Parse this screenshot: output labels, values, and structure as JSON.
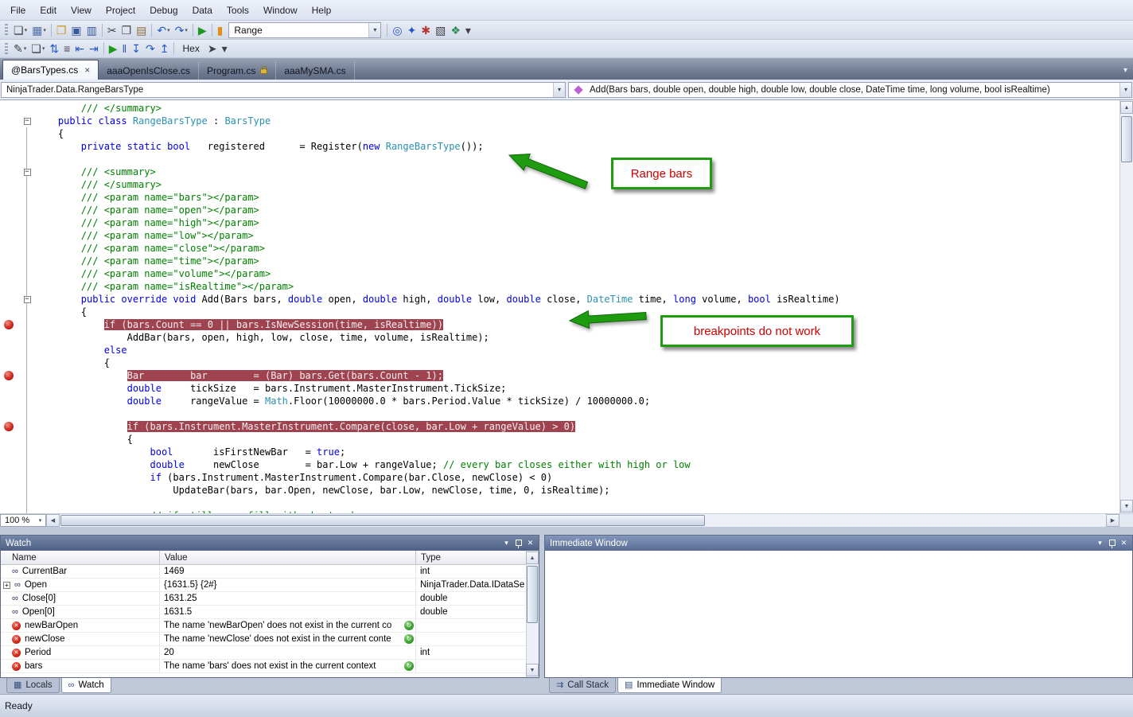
{
  "colors": {
    "breakpoint_highlight": "#A04350",
    "breakpoint_dot": "#CE2A1F",
    "annotation_border": "#1E9B0E",
    "annotation_text": "#D10000",
    "keyword": "#0000E8",
    "user_type": "#2B91AF",
    "comment": "#008000"
  },
  "menu": {
    "items": [
      "File",
      "Edit",
      "View",
      "Project",
      "Debug",
      "Data",
      "Tools",
      "Window",
      "Help"
    ]
  },
  "toolbar1": {
    "items": [
      {
        "k": "g"
      },
      {
        "k": "i",
        "n": "new-file-icon",
        "g": "❏",
        "c": "#3f4043",
        "caret": true
      },
      {
        "k": "i",
        "n": "add-item-icon",
        "g": "▦",
        "c": "#4f6fa8",
        "caret": true
      },
      {
        "k": "s"
      },
      {
        "k": "i",
        "n": "open-file-icon",
        "g": "❒",
        "c": "#c9971c"
      },
      {
        "k": "i",
        "n": "save-icon",
        "g": "▣",
        "c": "#34589c"
      },
      {
        "k": "i",
        "n": "save-all-icon",
        "g": "▥",
        "c": "#34589c"
      },
      {
        "k": "s"
      },
      {
        "k": "i",
        "n": "cut-icon",
        "g": "✂",
        "c": "#44464a"
      },
      {
        "k": "i",
        "n": "copy-icon",
        "g": "❐",
        "c": "#44464a"
      },
      {
        "k": "i",
        "n": "paste-icon",
        "g": "▤",
        "c": "#8a6d3b"
      },
      {
        "k": "s"
      },
      {
        "k": "i",
        "n": "undo-icon",
        "g": "↶",
        "c": "#2458c8",
        "caret": true
      },
      {
        "k": "i",
        "n": "redo-icon",
        "g": "↷",
        "c": "#2458c8",
        "caret": true
      },
      {
        "k": "s"
      },
      {
        "k": "i",
        "n": "start-debugging-icon",
        "g": "▶",
        "c": "#1d9a1d"
      },
      {
        "k": "s"
      },
      {
        "k": "i",
        "n": "new-breakpoint-icon",
        "g": "▮",
        "c": "#e09018"
      },
      {
        "k": "combo",
        "n": "solution-configurations-combo",
        "v": "Range",
        "w": 192
      },
      {
        "k": "s"
      },
      {
        "k": "i",
        "n": "find-in-files-icon",
        "g": "◎",
        "c": "#2458c8"
      },
      {
        "k": "i",
        "n": "find-symbol-icon",
        "g": "✦",
        "c": "#2458c8"
      },
      {
        "k": "i",
        "n": "build-icon",
        "g": "✱",
        "c": "#b03a2e"
      },
      {
        "k": "i",
        "n": "properties-window-icon",
        "g": "▧",
        "c": "#3f4043"
      },
      {
        "k": "i",
        "n": "extensions-icon",
        "g": "❖",
        "c": "#2e8b57"
      },
      {
        "k": "i",
        "n": "toolbar-options-icon",
        "g": "▾",
        "c": "#3f4043"
      }
    ]
  },
  "toolbar2": {
    "items": [
      {
        "k": "g"
      },
      {
        "k": "i",
        "n": "comment-icon",
        "g": "✎",
        "c": "#3f4043",
        "caret": true
      },
      {
        "k": "i",
        "n": "uncomment-icon",
        "g": "❏",
        "c": "#3f4043",
        "caret": true
      },
      {
        "k": "i",
        "n": "sort-icon",
        "g": "⇅",
        "c": "#2458c8"
      },
      {
        "k": "i",
        "n": "display-whitespace-icon",
        "g": "≡",
        "c": "#3f4043"
      },
      {
        "k": "i",
        "n": "decrease-indent-icon",
        "g": "⇤",
        "c": "#2458c8"
      },
      {
        "k": "i",
        "n": "increase-indent-icon",
        "g": "⇥",
        "c": "#2458c8"
      },
      {
        "k": "s"
      },
      {
        "k": "i",
        "n": "continue-icon",
        "g": "▶",
        "c": "#1d9a1d"
      },
      {
        "k": "i",
        "n": "break-all-icon",
        "g": "‖",
        "c": "#34589c"
      },
      {
        "k": "i",
        "n": "step-into-icon",
        "g": "↧",
        "c": "#2458c8"
      },
      {
        "k": "i",
        "n": "step-over-icon",
        "g": "↷",
        "c": "#2458c8"
      },
      {
        "k": "i",
        "n": "step-out-icon",
        "g": "↥",
        "c": "#2458c8"
      },
      {
        "k": "s"
      },
      {
        "k": "label",
        "n": "hex-display-toggle",
        "v": "Hex"
      },
      {
        "k": "i",
        "n": "pointer-icon",
        "g": "➤",
        "c": "#3f4043"
      },
      {
        "k": "i",
        "n": "toolbar-options-icon",
        "g": "▾",
        "c": "#3f4043"
      }
    ]
  },
  "tabs": [
    {
      "label": "@BarsTypes.cs",
      "active": true,
      "close": true
    },
    {
      "label": "aaaOpenIsClose.cs"
    },
    {
      "label": "Program.cs",
      "lock": true
    },
    {
      "label": "aaaMySMA.cs"
    }
  ],
  "navbar": {
    "type_dropdown": "NinjaTrader.Data.RangeBarsType",
    "member_dropdown": "Add(Bars bars, double open, double high, double low, double close, DateTime time, long volume, bool isRealtime)"
  },
  "editor": {
    "zoom": "100 %",
    "lines": [
      {
        "t": [
          [
            "c",
            "        /// </summary>"
          ]
        ]
      },
      {
        "fold": true,
        "t": [
          [
            "p",
            "    "
          ],
          [
            "k",
            "public class "
          ],
          [
            "y",
            "RangeBarsType"
          ],
          [
            "p",
            " : "
          ],
          [
            "y",
            "BarsType"
          ]
        ]
      },
      {
        "t": [
          [
            "p",
            "    {"
          ]
        ]
      },
      {
        "t": [
          [
            "p",
            "        "
          ],
          [
            "k",
            "private static bool"
          ],
          [
            "p",
            "   registered      = Register("
          ],
          [
            "k",
            "new "
          ],
          [
            "y",
            "RangeBarsType"
          ],
          [
            "p",
            "());"
          ]
        ]
      },
      {
        "t": []
      },
      {
        "fold": true,
        "t": [
          [
            "c",
            "        /// <summary>"
          ]
        ]
      },
      {
        "t": [
          [
            "c",
            "        /// </summary>"
          ]
        ]
      },
      {
        "t": [
          [
            "c",
            "        /// <param name=\"bars\"></param>"
          ]
        ]
      },
      {
        "t": [
          [
            "c",
            "        /// <param name=\"open\"></param>"
          ]
        ]
      },
      {
        "t": [
          [
            "c",
            "        /// <param name=\"high\"></param>"
          ]
        ]
      },
      {
        "t": [
          [
            "c",
            "        /// <param name=\"low\"></param>"
          ]
        ]
      },
      {
        "t": [
          [
            "c",
            "        /// <param name=\"close\"></param>"
          ]
        ]
      },
      {
        "t": [
          [
            "c",
            "        /// <param name=\"time\"></param>"
          ]
        ]
      },
      {
        "t": [
          [
            "c",
            "        /// <param name=\"volume\"></param>"
          ]
        ]
      },
      {
        "t": [
          [
            "c",
            "        /// <param name=\"isRealtime\"></param>"
          ]
        ]
      },
      {
        "fold": true,
        "t": [
          [
            "p",
            "        "
          ],
          [
            "k",
            "public override void"
          ],
          [
            "p",
            " Add(Bars bars, "
          ],
          [
            "k",
            "double"
          ],
          [
            "p",
            " open, "
          ],
          [
            "k",
            "double"
          ],
          [
            "p",
            " high, "
          ],
          [
            "k",
            "double"
          ],
          [
            "p",
            " low, "
          ],
          [
            "k",
            "double"
          ],
          [
            "p",
            " close, "
          ],
          [
            "y",
            "DateTime"
          ],
          [
            "p",
            " time, "
          ],
          [
            "k",
            "long"
          ],
          [
            "p",
            " volume, "
          ],
          [
            "k",
            "bool"
          ],
          [
            "p",
            " isRealtime)"
          ]
        ]
      },
      {
        "t": [
          [
            "p",
            "        {"
          ]
        ]
      },
      {
        "bp": true,
        "t": [
          [
            "p",
            "            "
          ],
          [
            "h",
            "if (bars.Count == 0 || bars.IsNewSession(time, isRealtime))"
          ]
        ]
      },
      {
        "t": [
          [
            "p",
            "                AddBar(bars, open, high, low, close, time, volume, isRealtime);"
          ]
        ]
      },
      {
        "t": [
          [
            "p",
            "            "
          ],
          [
            "k",
            "else"
          ]
        ]
      },
      {
        "t": [
          [
            "p",
            "            {"
          ]
        ]
      },
      {
        "bp": true,
        "t": [
          [
            "p",
            "                "
          ],
          [
            "h",
            "Bar        bar        = (Bar) bars.Get(bars.Count - 1);"
          ]
        ]
      },
      {
        "t": [
          [
            "p",
            "                "
          ],
          [
            "k",
            "double"
          ],
          [
            "p",
            "     tickSize   = bars.Instrument.MasterInstrument.TickSize;"
          ]
        ]
      },
      {
        "t": [
          [
            "p",
            "                "
          ],
          [
            "k",
            "double"
          ],
          [
            "p",
            "     rangeValue = "
          ],
          [
            "y",
            "Math"
          ],
          [
            "p",
            ".Floor(10000000.0 * bars.Period.Value * tickSize) / 10000000.0;"
          ]
        ]
      },
      {
        "t": []
      },
      {
        "bp": true,
        "t": [
          [
            "p",
            "                "
          ],
          [
            "h",
            "if (bars.Instrument.MasterInstrument.Compare(close, bar.Low + rangeValue) > 0)"
          ]
        ]
      },
      {
        "t": [
          [
            "p",
            "                {"
          ]
        ]
      },
      {
        "t": [
          [
            "p",
            "                    "
          ],
          [
            "k",
            "bool"
          ],
          [
            "p",
            "       isFirstNewBar   = "
          ],
          [
            "k",
            "true"
          ],
          [
            "p",
            ";"
          ]
        ]
      },
      {
        "t": [
          [
            "p",
            "                    "
          ],
          [
            "k",
            "double"
          ],
          [
            "p",
            "     newClose        = bar.Low + rangeValue; "
          ],
          [
            "c",
            "// every bar closes either with high or low"
          ]
        ]
      },
      {
        "t": [
          [
            "p",
            "                    "
          ],
          [
            "k",
            "if"
          ],
          [
            "p",
            " (bars.Instrument.MasterInstrument.Compare(bar.Close, newClose) < 0)"
          ]
        ]
      },
      {
        "t": [
          [
            "p",
            "                        UpdateBar(bars, bar.Open, newClose, bar.Low, newClose, time, 0, isRealtime);"
          ]
        ]
      },
      {
        "t": []
      },
      {
        "t": [
          [
            "c",
            "                    // if still gap, fill with phantom bars"
          ]
        ]
      }
    ]
  },
  "annotations": [
    {
      "label": "Range bars"
    },
    {
      "label": "breakpoints do not work"
    }
  ],
  "watch": {
    "title": "Watch",
    "columns": [
      "Name",
      "Value",
      "Type"
    ],
    "rows": [
      {
        "icon": "watch",
        "name": "CurrentBar",
        "value": "1469",
        "type": "int"
      },
      {
        "icon": "watch",
        "expand": true,
        "name": "Open",
        "value": "{1631.5} {2#}",
        "type": "NinjaTrader.Data.IDataSe"
      },
      {
        "icon": "watch",
        "name": "Close[0]",
        "value": "1631.25",
        "type": "double"
      },
      {
        "icon": "watch",
        "name": "Open[0]",
        "value": "1631.5",
        "type": "double"
      },
      {
        "icon": "error",
        "name": "newBarOpen",
        "value": "The name 'newBarOpen' does not exist in the current co",
        "type": "",
        "refresh": true
      },
      {
        "icon": "error",
        "name": "newClose",
        "value": "The name 'newClose' does not exist in the current conte",
        "type": "",
        "refresh": true
      },
      {
        "icon": "error",
        "name": "Period",
        "value": "20",
        "type": "int"
      },
      {
        "icon": "error",
        "name": "bars",
        "value": "The name 'bars' does not exist in the current context",
        "type": "",
        "refresh": true
      }
    ],
    "tabs": [
      {
        "label": "Locals",
        "icon": "▦"
      },
      {
        "label": "Watch",
        "active": true,
        "icon": "∞"
      }
    ]
  },
  "immediate": {
    "title": "Immediate Window",
    "tabs": [
      {
        "label": "Call Stack",
        "icon": "⇉"
      },
      {
        "label": "Immediate Window",
        "active": true,
        "icon": "▤"
      }
    ]
  },
  "statusbar": {
    "text": "Ready"
  }
}
